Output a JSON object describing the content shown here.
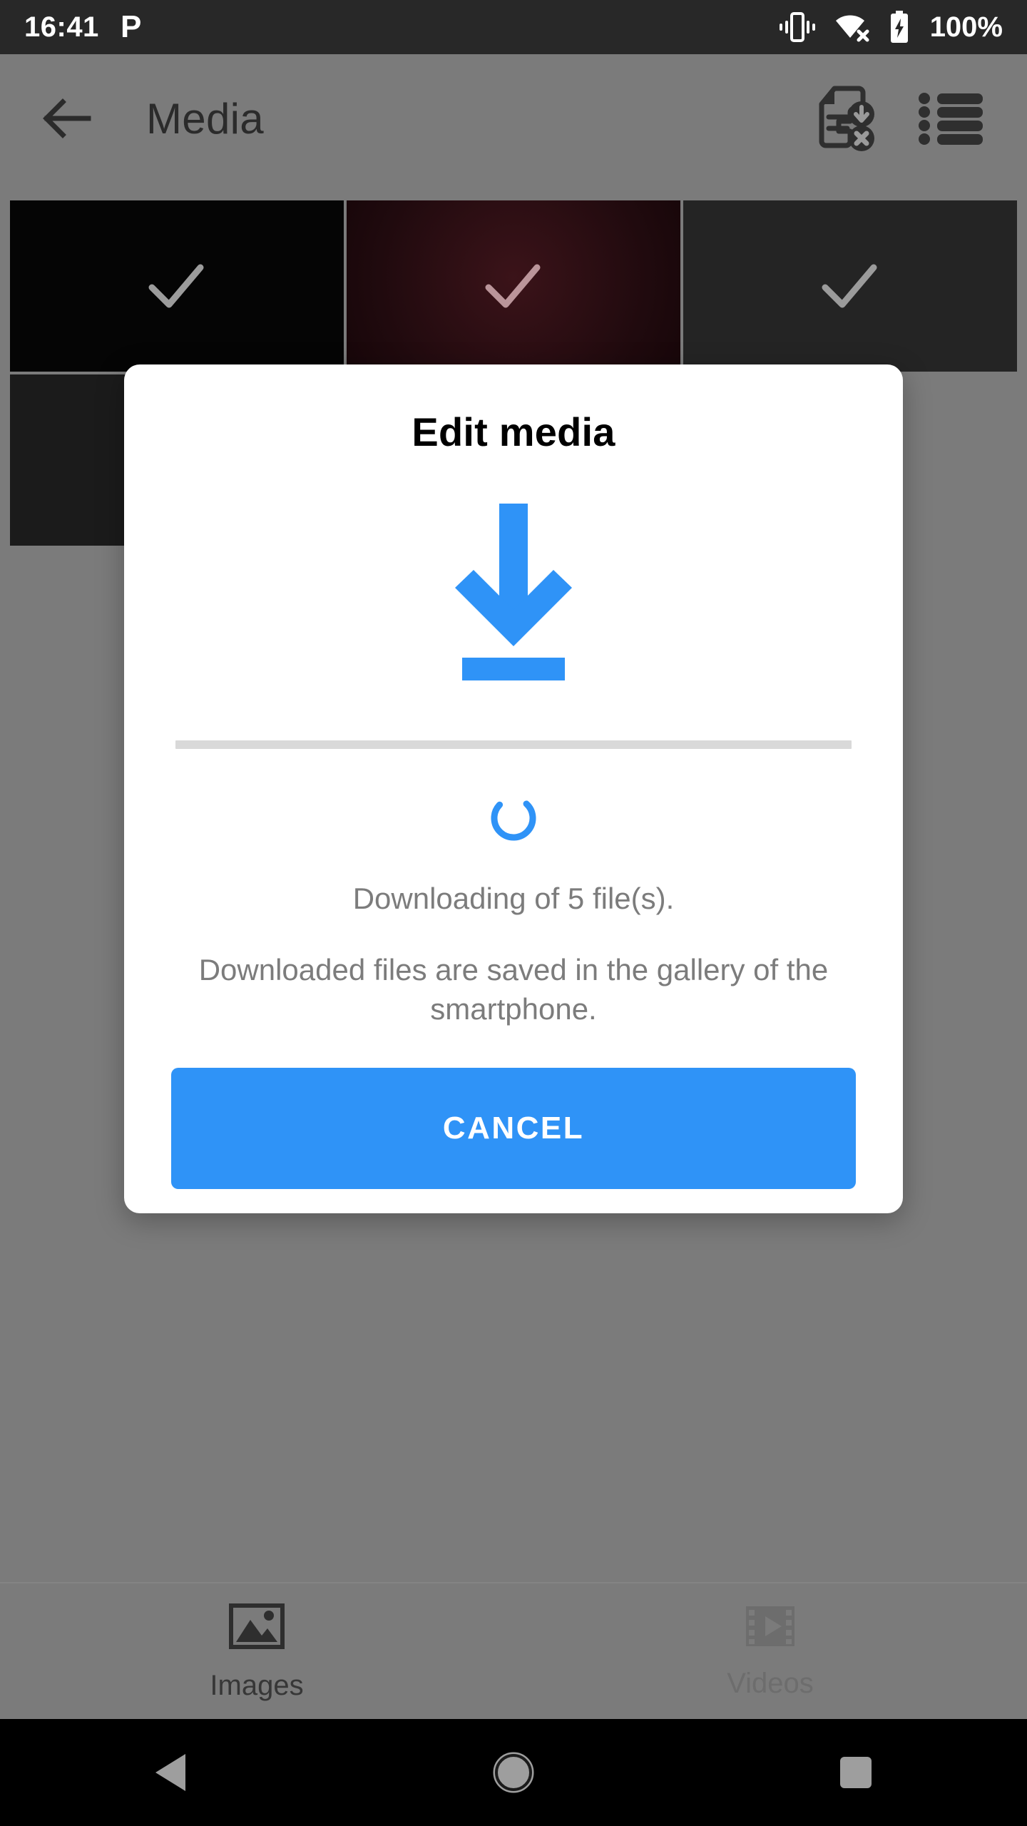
{
  "status_bar": {
    "clock": "16:41",
    "app_icon": "P",
    "icons": [
      "vibrate-icon",
      "wifi-off-icon",
      "battery-charging-icon"
    ],
    "battery_percent": "100%",
    "background_color": "#282828",
    "text_color": "#ffffff"
  },
  "appbar": {
    "back_icon": "arrow-left-icon",
    "title": "Media",
    "actions": [
      {
        "icon": "document-download-cancel-icon",
        "name": "cancel-downloads-button"
      },
      {
        "icon": "list-view-icon",
        "name": "list-view-button"
      }
    ]
  },
  "media_grid": {
    "items": [
      {
        "name": "media-thumbnail",
        "selected": true,
        "color": "#050505",
        "check": "checkmark-icon"
      },
      {
        "name": "media-thumbnail",
        "selected": true,
        "color": "#2a0d12",
        "check": "checkmark-icon"
      },
      {
        "name": "media-thumbnail",
        "selected": true,
        "color": "#242424",
        "check": "checkmark-icon"
      },
      {
        "name": "media-thumbnail",
        "selected": false,
        "color": "#1b1b1b",
        "check": ""
      }
    ]
  },
  "dialog": {
    "title": "Edit media",
    "download_icon": "download-arrow-icon",
    "progress": {
      "percent": 0,
      "track_color": "#d9d9d9",
      "fill_color": "#2f93f7"
    },
    "spinner": {
      "icon": "loading-spinner-icon",
      "color": "#2f93f7"
    },
    "status_text": "Downloading of 5 file(s).",
    "hint_text": "Downloaded files are saved in the gallery of the smartphone.",
    "cancel_label": "CANCEL",
    "accent_color": "#2f93f7",
    "background_color": "#ffffff"
  },
  "tab_bar": {
    "tabs": [
      {
        "label": "Images",
        "icon": "image-icon",
        "selected": true
      },
      {
        "label": "Videos",
        "icon": "video-film-icon",
        "selected": false
      }
    ]
  },
  "nav_bar": {
    "buttons": [
      {
        "name": "nav-back-button",
        "icon": "triangle-back-icon"
      },
      {
        "name": "nav-home-button",
        "icon": "circle-home-icon"
      },
      {
        "name": "nav-recents-button",
        "icon": "square-recents-icon"
      }
    ]
  }
}
